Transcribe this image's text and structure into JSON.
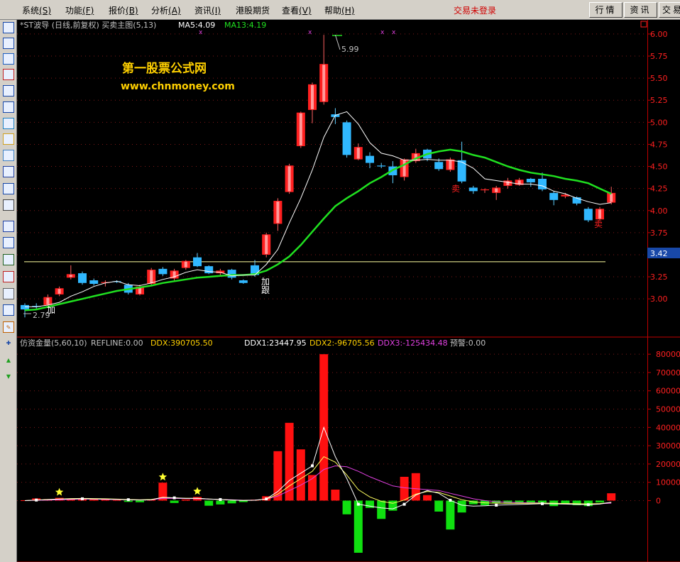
{
  "menu": [
    {
      "label": "系统",
      "key": "(S)"
    },
    {
      "label": "功能",
      "key": "(F)"
    },
    {
      "label": "报价",
      "key": "(B)"
    },
    {
      "label": "分析",
      "key": "(A)"
    },
    {
      "label": "资讯",
      "key": "(I)"
    },
    {
      "label": "港股期货",
      "key": ""
    },
    {
      "label": "查看",
      "key": "(V)"
    },
    {
      "label": "帮助",
      "key": "(H)"
    }
  ],
  "login_status": "交易未登录",
  "top_buttons": [
    "行情",
    "资讯",
    "交易"
  ],
  "toolbar_icons": [
    "table-icon",
    "list-icon",
    "line-chart-icon",
    "candle-icon",
    "grid-icon",
    "report-icon",
    "info-icon",
    "news-icon",
    "people-icon",
    "fx-icon",
    "search-icon",
    "exit-icon",
    "wave-icon",
    "rsi-icon",
    "calc-icon",
    "stock-icon",
    "link-icon",
    "export-icon",
    "pen-icon",
    "move-icon",
    "up-arrow-icon",
    "down-arrow-icon"
  ],
  "price_panel": {
    "title": "*ST波导 (日线,前复权) 买卖主图(5,13)",
    "ma5": "MA5:4.09",
    "ma13": "MA13:4.19",
    "watermark_name": "第一股票公式网",
    "watermark_url": "www.chnmoney.com",
    "high_label": "5.99",
    "low_label": "2.79",
    "current_price": "3.42",
    "annotations": [
      "加",
      "加",
      "跟",
      "卖",
      "卖"
    ],
    "colors": {
      "up": "#ff2020",
      "down": "#30b8ff",
      "ma5": "#ffffff",
      "ma13": "#20e020"
    }
  },
  "indicator_panel": {
    "title": "仿资金量(5,60,10)",
    "refline": "REFLINE:0.00",
    "ddx": "DDX:390705.50",
    "ddx1": "DDX1:23447.95",
    "ddx2": "DDX2:-96705.56",
    "ddx3": "DDX3:-125434.48",
    "warn": "预警:0.00"
  },
  "chart_data": [
    {
      "type": "candlestick",
      "title": "*ST波导 (日线,前复权) 买卖主图(5,13)",
      "y_ticks": [
        "6.00",
        "5.75",
        "5.50",
        "5.25",
        "5.00",
        "4.75",
        "4.50",
        "4.25",
        "4.00",
        "3.75",
        "3.50",
        "3.25",
        "3.00"
      ],
      "ylim": [
        2.72,
        6.12
      ],
      "reference_line": 3.42,
      "candles": [
        [
          2.93,
          2.88,
          2.95,
          2.79
        ],
        [
          2.92,
          2.91,
          2.95,
          2.88
        ],
        [
          2.93,
          3.02,
          3.05,
          2.9
        ],
        [
          3.05,
          3.12,
          3.14,
          3.03
        ],
        [
          3.24,
          3.28,
          3.38,
          3.22
        ],
        [
          3.29,
          3.18,
          3.31,
          3.16
        ],
        [
          3.21,
          3.17,
          3.23,
          3.15
        ],
        [
          3.18,
          3.19,
          3.21,
          3.14
        ],
        [
          3.2,
          3.19,
          3.21,
          3.18
        ],
        [
          3.16,
          3.07,
          3.18,
          3.05
        ],
        [
          3.05,
          3.14,
          3.16,
          3.04
        ],
        [
          3.17,
          3.33,
          3.35,
          3.15
        ],
        [
          3.34,
          3.28,
          3.36,
          3.26
        ],
        [
          3.23,
          3.32,
          3.34,
          3.21
        ],
        [
          3.35,
          3.43,
          3.44,
          3.33
        ],
        [
          3.47,
          3.37,
          3.52,
          3.36
        ],
        [
          3.37,
          3.29,
          3.38,
          3.28
        ],
        [
          3.29,
          3.32,
          3.34,
          3.27
        ],
        [
          3.33,
          3.24,
          3.34,
          3.22
        ],
        [
          3.21,
          3.18,
          3.22,
          3.17
        ],
        [
          3.38,
          3.27,
          3.44,
          3.25
        ],
        [
          3.5,
          3.73,
          3.75,
          3.47
        ],
        [
          3.85,
          4.11,
          4.14,
          3.77
        ],
        [
          4.21,
          4.51,
          4.53,
          4.19
        ],
        [
          4.73,
          5.11,
          5.12,
          4.71
        ],
        [
          5.14,
          5.43,
          5.45,
          4.99
        ],
        [
          5.23,
          5.66,
          5.99,
          5.2
        ],
        [
          5.09,
          5.06,
          5.16,
          4.98
        ],
        [
          5.0,
          4.63,
          5.02,
          4.6
        ],
        [
          4.58,
          4.72,
          4.76,
          4.57
        ],
        [
          4.62,
          4.54,
          4.66,
          4.48
        ],
        [
          4.51,
          4.5,
          4.54,
          4.48
        ],
        [
          4.5,
          4.4,
          4.56,
          4.31
        ],
        [
          4.38,
          4.58,
          4.59,
          4.34
        ],
        [
          4.56,
          4.65,
          4.7,
          4.54
        ],
        [
          4.69,
          4.59,
          4.7,
          4.56
        ],
        [
          4.55,
          4.47,
          4.59,
          4.45
        ],
        [
          4.46,
          4.58,
          4.6,
          4.44
        ],
        [
          4.57,
          4.33,
          4.78,
          4.31
        ],
        [
          4.26,
          4.22,
          4.28,
          4.19
        ],
        [
          4.23,
          4.24,
          4.25,
          4.2
        ],
        [
          4.2,
          4.26,
          4.28,
          4.12
        ],
        [
          4.28,
          4.34,
          4.37,
          4.25
        ],
        [
          4.29,
          4.35,
          4.37,
          4.28
        ],
        [
          4.36,
          4.32,
          4.37,
          4.27
        ],
        [
          4.36,
          4.24,
          4.43,
          4.22
        ],
        [
          4.2,
          4.12,
          4.22,
          4.06
        ],
        [
          4.16,
          4.18,
          4.2,
          4.14
        ],
        [
          4.15,
          4.08,
          4.16,
          4.06
        ],
        [
          4.02,
          3.89,
          4.04,
          3.87
        ],
        [
          3.9,
          4.02,
          4.04,
          3.89
        ],
        [
          4.09,
          4.2,
          4.27,
          4.07
        ]
      ],
      "series": [
        {
          "name": "MA5",
          "values": [
            2.91,
            2.91,
            2.93,
            2.96,
            3.03,
            3.08,
            3.14,
            3.18,
            3.2,
            3.16,
            3.15,
            3.18,
            3.22,
            3.25,
            3.3,
            3.33,
            3.31,
            3.3,
            3.26,
            3.27,
            3.27,
            3.39,
            3.56,
            3.86,
            4.14,
            4.46,
            4.83,
            5.08,
            5.12,
            4.98,
            4.77,
            4.65,
            4.62,
            4.57,
            4.57,
            4.58,
            4.57,
            4.57,
            4.55,
            4.48,
            4.36,
            4.34,
            4.32,
            4.3,
            4.3,
            4.28,
            4.22,
            4.19,
            4.14,
            4.1,
            4.07,
            4.09
          ]
        },
        {
          "name": "MA13",
          "values": [
            2.87,
            2.88,
            2.91,
            2.94,
            2.97,
            3.0,
            3.03,
            3.06,
            3.09,
            3.11,
            3.13,
            3.15,
            3.18,
            3.2,
            3.22,
            3.24,
            3.25,
            3.26,
            3.27,
            3.27,
            3.28,
            3.32,
            3.39,
            3.48,
            3.61,
            3.76,
            3.91,
            4.05,
            4.14,
            4.22,
            4.31,
            4.38,
            4.46,
            4.52,
            4.59,
            4.64,
            4.67,
            4.69,
            4.67,
            4.63,
            4.6,
            4.55,
            4.5,
            4.46,
            4.43,
            4.41,
            4.39,
            4.36,
            4.34,
            4.31,
            4.25,
            4.19
          ]
        }
      ]
    },
    {
      "type": "bar",
      "title": "仿资金量(5,60,10)",
      "y_ticks": [
        "80000",
        "70000",
        "60000",
        "50000",
        "40000",
        "30000",
        "20000",
        "10000",
        "0"
      ],
      "ylim": [
        -32000,
        82000
      ],
      "values": [
        200,
        1200,
        800,
        1500,
        800,
        1200,
        600,
        800,
        300,
        -700,
        -900,
        700,
        9800,
        -1300,
        600,
        2000,
        -2800,
        -2100,
        -1500,
        -800,
        500,
        2400,
        27000,
        42500,
        28000,
        14000,
        80000,
        6000,
        -7500,
        -28500,
        -4000,
        -10000,
        -5500,
        13000,
        15000,
        3000,
        -6000,
        -15800,
        -6500,
        -2000,
        -2500,
        -1500,
        -1600,
        -1600,
        -1300,
        -1100,
        -3000,
        -1500,
        -2500,
        -3000,
        -1000,
        4000
      ],
      "series": [
        {
          "name": "DDX1",
          "values": [
            0,
            300,
            500,
            800,
            900,
            1000,
            900,
            800,
            700,
            500,
            300,
            400,
            1800,
            1500,
            1200,
            1300,
            900,
            600,
            300,
            100,
            200,
            900,
            5000,
            11000,
            15000,
            19000,
            40000,
            24000,
            12000,
            -2000,
            -3000,
            -4000,
            -4500,
            -2000,
            3000,
            5500,
            4000,
            200,
            -2500,
            -3000,
            -2800,
            -2500,
            -2300,
            -2100,
            -1900,
            -1700,
            -1800,
            -1900,
            -2100,
            -2200,
            -1900,
            -900
          ]
        },
        {
          "name": "DDX2",
          "values": [
            0,
            300,
            600,
            900,
            1100,
            1200,
            1100,
            1000,
            800,
            600,
            400,
            600,
            1700,
            1500,
            1300,
            1200,
            900,
            600,
            300,
            100,
            200,
            800,
            3500,
            8000,
            12000,
            16000,
            24000,
            21000,
            14000,
            6000,
            2000,
            -400,
            -1500,
            300,
            3500,
            5000,
            4500,
            2500,
            500,
            -700,
            -1200,
            -1400,
            -1500,
            -1500,
            -1500,
            -1400,
            -1500,
            -1600,
            -1700,
            -1800,
            -1600,
            -1000
          ]
        },
        {
          "name": "DDX3",
          "values": [
            0,
            200,
            300,
            500,
            700,
            800,
            800,
            700,
            600,
            500,
            400,
            500,
            1200,
            1200,
            1100,
            1000,
            800,
            600,
            400,
            200,
            300,
            800,
            2500,
            5500,
            8500,
            12000,
            17000,
            19000,
            18500,
            16000,
            13000,
            10500,
            8000,
            7000,
            6500,
            6000,
            5500,
            4000,
            2500,
            1000,
            0,
            -600,
            -900,
            -1100,
            -1200,
            -1300,
            -1500,
            -1600,
            -1700,
            -1800,
            -1700,
            -1400
          ]
        }
      ],
      "markers": [
        {
          "index": 3,
          "type": "star"
        },
        {
          "index": 12,
          "type": "star"
        },
        {
          "index": 15,
          "type": "star"
        }
      ]
    }
  ]
}
